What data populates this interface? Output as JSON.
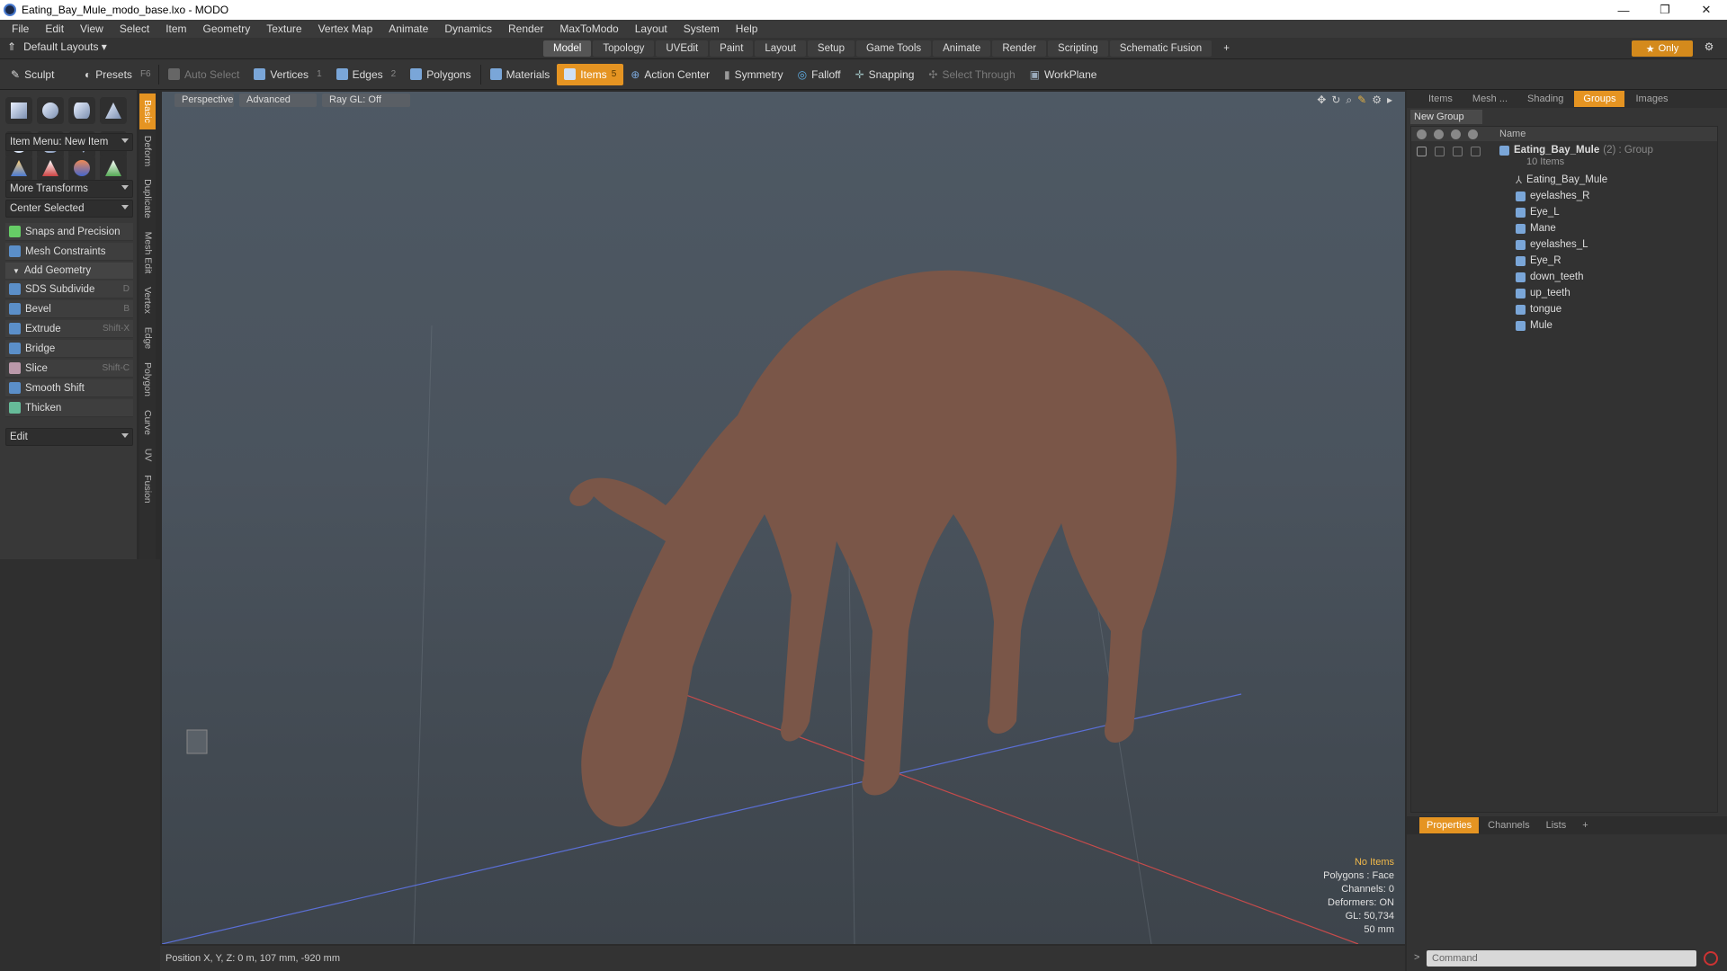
{
  "window": {
    "title": "Eating_Bay_Mule_modo_base.lxo - MODO",
    "minimize": "—",
    "maximize": "❐",
    "close": "✕"
  },
  "menu": [
    "File",
    "Edit",
    "View",
    "Select",
    "Item",
    "Geometry",
    "Texture",
    "Vertex Map",
    "Animate",
    "Dynamics",
    "Render",
    "MaxToModo",
    "Layout",
    "System",
    "Help"
  ],
  "layout": {
    "selector": "Default Layouts ▾",
    "tabs": [
      "Model",
      "Topology",
      "UVEdit",
      "Paint",
      "Layout",
      "Setup",
      "Game Tools",
      "Animate",
      "Render",
      "Scripting",
      "Schematic Fusion"
    ],
    "active": "Model",
    "add": "+",
    "only": "Only"
  },
  "toolbar": {
    "sculpt": "Sculpt",
    "presets": "Presets",
    "presets_key": "F6",
    "auto_select": "Auto Select",
    "vertices": "Vertices",
    "vertices_num": "1",
    "edges": "Edges",
    "edges_num": "2",
    "polygons": "Polygons",
    "materials": "Materials",
    "items": "Items",
    "items_num": "5",
    "action_center": "Action Center",
    "symmetry": "Symmetry",
    "falloff": "Falloff",
    "snapping": "Snapping",
    "select_through": "Select Through",
    "workplane": "WorkPlane"
  },
  "lefttools": {
    "item_menu": "Item Menu: New Item",
    "more_transforms": "More Transforms",
    "center_selected": "Center Selected",
    "snaps": "Snaps and Precision",
    "mesh_constraints": "Mesh Constraints",
    "add_geometry": "Add Geometry",
    "tools": [
      {
        "label": "SDS Subdivide",
        "key": "D"
      },
      {
        "label": "Bevel",
        "key": "B"
      },
      {
        "label": "Extrude",
        "key": "Shift-X"
      },
      {
        "label": "Bridge",
        "key": ""
      },
      {
        "label": "Slice",
        "key": "Shift-C"
      },
      {
        "label": "Smooth Shift",
        "key": ""
      },
      {
        "label": "Thicken",
        "key": ""
      }
    ],
    "edit": "Edit",
    "vtabs": [
      "Basic",
      "Deform",
      "Duplicate",
      "Mesh Edit",
      "Vertex",
      "Edge",
      "Polygon",
      "Curve",
      "UV",
      "Fusion"
    ]
  },
  "viewport": {
    "buttons": [
      "Perspective",
      "Advanced",
      "Ray GL: Off"
    ],
    "info": {
      "no_items": "No Items",
      "polygons": "Polygons : Face",
      "channels": "Channels: 0",
      "deformers": "Deformers: ON",
      "gl": "GL: 50,734",
      "focal": "50 mm"
    }
  },
  "status": {
    "position": "Position X, Y, Z:   0 m, 107 mm, -920 mm"
  },
  "rightpanel": {
    "tabs": [
      "Items",
      "Mesh ...",
      "Shading",
      "Groups",
      "Images"
    ],
    "active": "Groups",
    "new_group": "New Group",
    "name_header": "Name",
    "group_name": "Eating_Bay_Mule",
    "group_suffix": "(2) : Group",
    "group_count": "10 Items",
    "items": [
      "Eating_Bay_Mule",
      "eyelashes_R",
      "Eye_L",
      "Mane",
      "eyelashes_L",
      "Eye_R",
      "down_teeth",
      "up_teeth",
      "tongue",
      "Mule"
    ]
  },
  "properties": {
    "tabs": [
      "Properties",
      "Channels",
      "Lists"
    ],
    "active": "Properties",
    "add": "+"
  },
  "command": {
    "placeholder": "Command",
    "prompt": ">"
  }
}
